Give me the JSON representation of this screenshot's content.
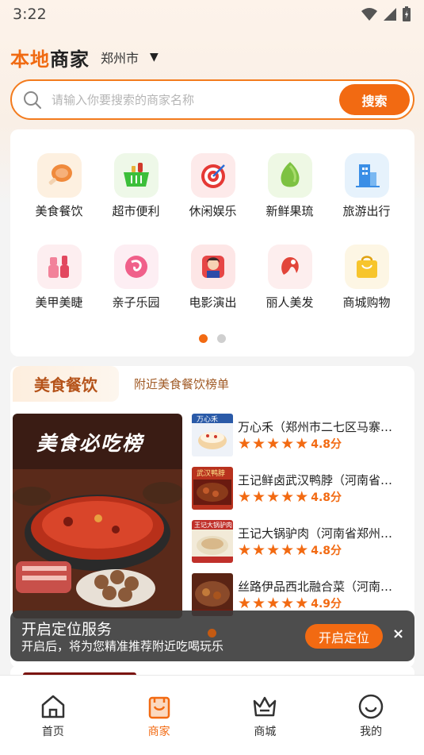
{
  "status_bar": {
    "time": "3:22"
  },
  "header": {
    "brand_part1": "本地",
    "brand_part2": "商家",
    "city": "郑州市",
    "caret": "▼"
  },
  "search": {
    "placeholder": "请输入你要搜索的商家名称",
    "button_label": "搜索"
  },
  "categories": [
    {
      "label": "美食餐饮",
      "icon": "ham-icon"
    },
    {
      "label": "超市便利",
      "icon": "shopping-basket-icon"
    },
    {
      "label": "休闲娱乐",
      "icon": "target-icon"
    },
    {
      "label": "新鲜果琉",
      "icon": "fruit-icon"
    },
    {
      "label": "旅游出行",
      "icon": "building-icon"
    },
    {
      "label": "美甲美睫",
      "icon": "nail-polish-icon"
    },
    {
      "label": "亲子乐园",
      "icon": "baby-icon"
    },
    {
      "label": "电影演出",
      "icon": "actor-icon"
    },
    {
      "label": "丽人美发",
      "icon": "hair-icon"
    },
    {
      "label": "商城购物",
      "icon": "shopping-bag-icon"
    }
  ],
  "category_pager": {
    "pages": 2,
    "active": 0
  },
  "food_section": {
    "title": "美食餐饮",
    "subtitle": "附近美食餐饮榜单",
    "banner_text": "美食必吃榜",
    "rankings": [
      {
        "name": "万心禾（郑州市二七区马寨镇店）",
        "stars": 5,
        "score": "4.8分",
        "thumb_text": "万心禾"
      },
      {
        "name": "王记鲜卤武汉鸭脖（河南省郑州市）",
        "stars": 5,
        "score": "4.8分",
        "thumb_text": "武汉鸭脖"
      },
      {
        "name": "王记大锅驴肉（河南省郑州市店）",
        "stars": 5,
        "score": "4.8分",
        "thumb_text": "王记大锅驴肉"
      },
      {
        "name": "丝路伊品西北融合菜（河南店）",
        "stars": 5,
        "score": "4.9分",
        "thumb_text": ""
      }
    ]
  },
  "toast": {
    "title": "开启定位服务",
    "subtitle": "开启后，将为您精准推荐附近吃喝玩乐",
    "button_label": "开启定位",
    "close": "×"
  },
  "tabbar": [
    {
      "label": "首页",
      "icon": "home-icon",
      "active": false
    },
    {
      "label": "商家",
      "icon": "shop-bag-icon",
      "active": true
    },
    {
      "label": "商城",
      "icon": "crown-icon",
      "active": false
    },
    {
      "label": "我的",
      "icon": "smile-icon",
      "active": false
    }
  ],
  "colors": {
    "accent": "#f26a12",
    "brand_orange": "#f06a12"
  }
}
